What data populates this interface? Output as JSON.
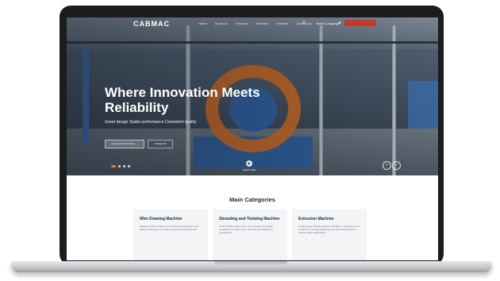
{
  "header": {
    "logo_text": "CABMAC",
    "nav_items": [
      "Home",
      "About Us",
      "Products",
      "Services",
      "Portfolio",
      "Contact Us"
    ],
    "language": "Select Language",
    "icons": [
      "search-icon",
      "globe-icon"
    ]
  },
  "hero": {
    "title": "Where Innovation Meets Reliability",
    "subtitle": "Smart design Stable performance Consistent quality",
    "primary_button": "Explore Our Machines →",
    "secondary_button": "Contact Us",
    "caption": "Watch Video",
    "slides_count": 4,
    "active_slide": 1,
    "prev_icon": "chevron-left-icon",
    "next_icon": "chevron-right-icon",
    "accent_color": "#e07b2a"
  },
  "categories": {
    "title": "Main Categories",
    "cards": [
      {
        "title": "Wire Drawing Machine",
        "text": "Reduce copper or aluminum rod diameter through multi-stage drawing dies to produce precise conductive wire."
      },
      {
        "title": "Stranding and Twisting Machine",
        "text": "Twist multiple single wires into compact, concentric conductors or cable cores, optimizing flexibility and conductivity."
      },
      {
        "title": "Extrusion Machine",
        "text": "Continuously extrude polymer insulation or sheathing onto conductors, forming protective and functional layers for diverse cable applications."
      }
    ]
  }
}
